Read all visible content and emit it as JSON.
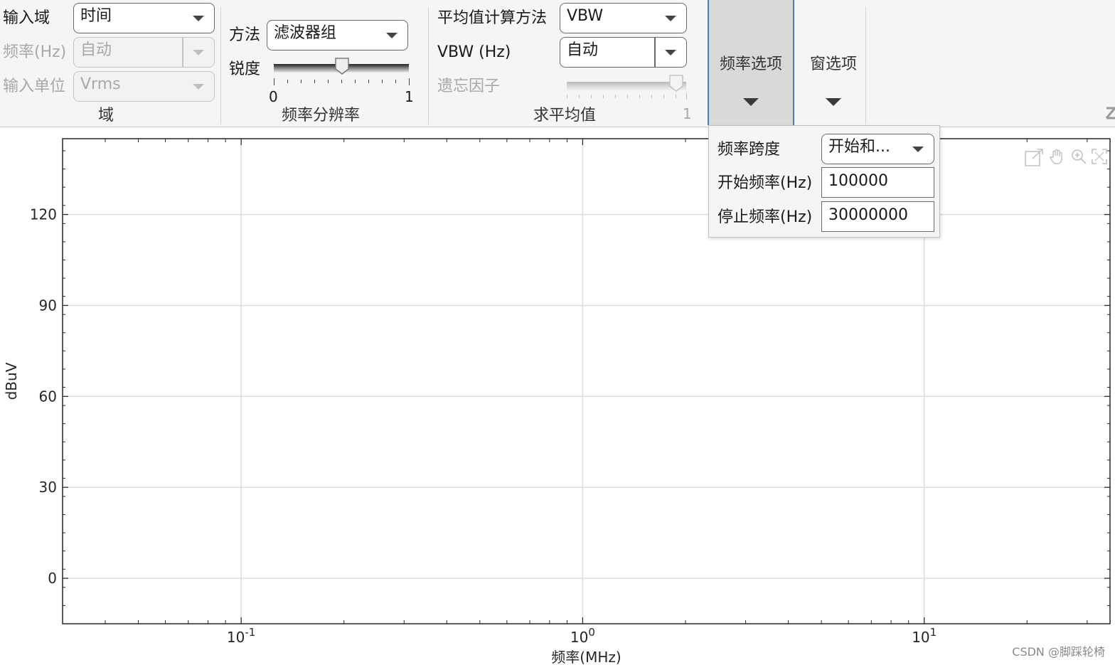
{
  "toolstrip": {
    "domain_group": {
      "title": "域",
      "input_domain": {
        "label": "输入域",
        "value": "时间"
      },
      "frequency": {
        "label": "频率(Hz)",
        "value": "自动"
      },
      "input_unit": {
        "label": "输入单位",
        "value": "Vrms"
      }
    },
    "resolution_group": {
      "title": "频率分辨率",
      "method": {
        "label": "方法",
        "value": "滤波器组"
      },
      "sharpness": {
        "label": "锐度",
        "min": "0",
        "max": "1",
        "value": 0.5
      }
    },
    "averaging_group": {
      "title": "求平均值",
      "avg_method": {
        "label": "平均值计算方法",
        "value": "VBW"
      },
      "vbw": {
        "label": "VBW (Hz)",
        "value": "自动"
      },
      "forgetting": {
        "label": "遗忘因子",
        "max": "1",
        "value": 0.9
      }
    },
    "freq_options_button": "频率选项",
    "window_options_button": "窗选项"
  },
  "popup": {
    "span": {
      "label": "频率跨度",
      "value": "开始和..."
    },
    "start": {
      "label": "开始频率(Hz)",
      "value": "100000"
    },
    "stop": {
      "label": "停止频率(Hz)",
      "value": "30000000"
    }
  },
  "chart_data": {
    "type": "line",
    "x_scale": "log",
    "xlim": [
      0.03,
      35
    ],
    "ylim": [
      -15,
      145
    ],
    "xlabel": "频率(MHz)",
    "ylabel": "dBuV",
    "x_ticks": [
      {
        "value": 0.1,
        "base": "10",
        "exp": "-1"
      },
      {
        "value": 1,
        "base": "10",
        "exp": "0"
      },
      {
        "value": 10,
        "base": "10",
        "exp": "1"
      }
    ],
    "y_ticks": [
      "0",
      "30",
      "60",
      "90",
      "120"
    ],
    "grid": true,
    "series": []
  },
  "axes_toolbar": [
    "export-icon",
    "pan-hand-icon",
    "zoom-in-icon",
    "restore-view-icon"
  ],
  "watermark": "CSDN @脚踩轮椅",
  "colors": {
    "grid": "#dcdcdc",
    "axis": "#262626",
    "toolstrip_bg": "#f5f5f5",
    "selected_button": "#d9d9d9",
    "selected_border": "#4a7fc1"
  }
}
